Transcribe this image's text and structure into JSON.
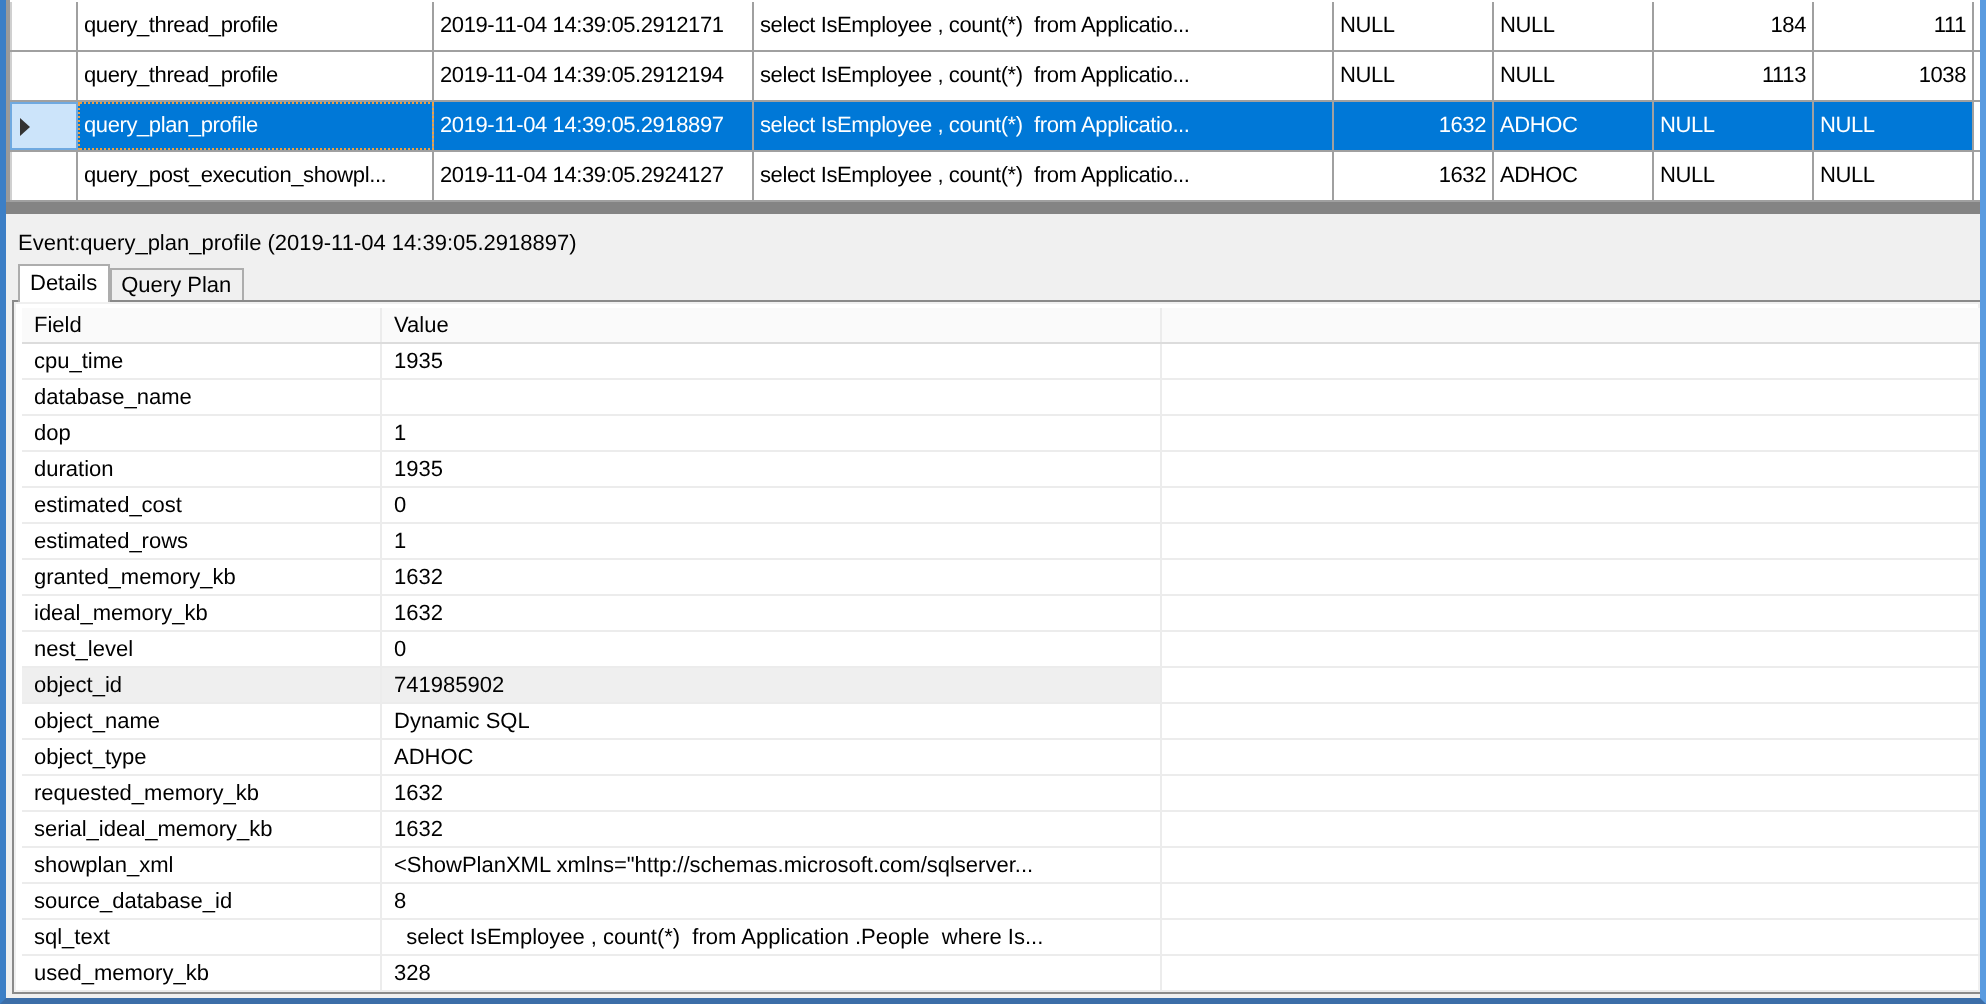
{
  "events_grid": {
    "rows": [
      {
        "selected": false,
        "cells": [
          {
            "text": "query_thread_profile",
            "kind": "text"
          },
          {
            "text": "2019-11-04 14:39:05.2912171",
            "kind": "text"
          },
          {
            "text": "select IsEmployee , count(*)  from Applicatio...",
            "kind": "text"
          },
          {
            "text": "NULL",
            "kind": "text"
          },
          {
            "text": "NULL",
            "kind": "text"
          },
          {
            "text": "184",
            "kind": "number"
          },
          {
            "text": "111",
            "kind": "number"
          }
        ]
      },
      {
        "selected": false,
        "cells": [
          {
            "text": "query_thread_profile",
            "kind": "text"
          },
          {
            "text": "2019-11-04 14:39:05.2912194",
            "kind": "text"
          },
          {
            "text": "select IsEmployee , count(*)  from Applicatio...",
            "kind": "text"
          },
          {
            "text": "NULL",
            "kind": "text"
          },
          {
            "text": "NULL",
            "kind": "text"
          },
          {
            "text": "1113",
            "kind": "number"
          },
          {
            "text": "1038",
            "kind": "number"
          }
        ]
      },
      {
        "selected": true,
        "cells": [
          {
            "text": "query_plan_profile",
            "kind": "text"
          },
          {
            "text": "2019-11-04 14:39:05.2918897",
            "kind": "text"
          },
          {
            "text": "select IsEmployee , count(*)  from Applicatio...",
            "kind": "text"
          },
          {
            "text": "1632",
            "kind": "number"
          },
          {
            "text": "ADHOC",
            "kind": "text"
          },
          {
            "text": "NULL",
            "kind": "text"
          },
          {
            "text": "NULL",
            "kind": "text"
          }
        ]
      },
      {
        "selected": false,
        "cells": [
          {
            "text": "query_post_execution_showpl...",
            "kind": "text"
          },
          {
            "text": "2019-11-04 14:39:05.2924127",
            "kind": "text"
          },
          {
            "text": "select IsEmployee , count(*)  from Applicatio...",
            "kind": "text"
          },
          {
            "text": "1632",
            "kind": "number"
          },
          {
            "text": "ADHOC",
            "kind": "text"
          },
          {
            "text": "NULL",
            "kind": "text"
          },
          {
            "text": "NULL",
            "kind": "text"
          }
        ]
      }
    ]
  },
  "event_title": "Event:query_plan_profile (2019-11-04 14:39:05.2918897)",
  "tabs": [
    {
      "label": "Details",
      "selected": true
    },
    {
      "label": "Query Plan",
      "selected": false
    }
  ],
  "details": {
    "columns": [
      "Field",
      "Value"
    ],
    "rows": [
      {
        "field": "cpu_time",
        "value": "1935",
        "selected": false
      },
      {
        "field": "database_name",
        "selected": false
      },
      {
        "field": "dop",
        "value": "1",
        "selected": false
      },
      {
        "field": "duration",
        "value": "1935",
        "selected": false
      },
      {
        "field": "estimated_cost",
        "value": "0",
        "selected": false
      },
      {
        "field": "estimated_rows",
        "value": "1",
        "selected": false
      },
      {
        "field": "granted_memory_kb",
        "value": "1632",
        "selected": false
      },
      {
        "field": "ideal_memory_kb",
        "value": "1632",
        "selected": false
      },
      {
        "field": "nest_level",
        "value": "0",
        "selected": false
      },
      {
        "field": "object_id",
        "value": "741985902",
        "selected": true
      },
      {
        "field": "object_name",
        "value": "Dynamic SQL",
        "selected": false
      },
      {
        "field": "object_type",
        "value": "ADHOC",
        "selected": false
      },
      {
        "field": "requested_memory_kb",
        "value": "1632",
        "selected": false
      },
      {
        "field": "serial_ideal_memory_kb",
        "value": "1632",
        "selected": false
      },
      {
        "field": "showplan_xml",
        "value": "<ShowPlanXML xmlns=\"http://schemas.microsoft.com/sqlserver...",
        "selected": false
      },
      {
        "field": "source_database_id",
        "value": "8",
        "selected": false
      },
      {
        "field": "sql_text",
        "value": "  select IsEmployee , count(*)  from Application .People  where Is...",
        "selected": false
      },
      {
        "field": "used_memory_kb",
        "value": "328",
        "selected": false
      }
    ]
  }
}
